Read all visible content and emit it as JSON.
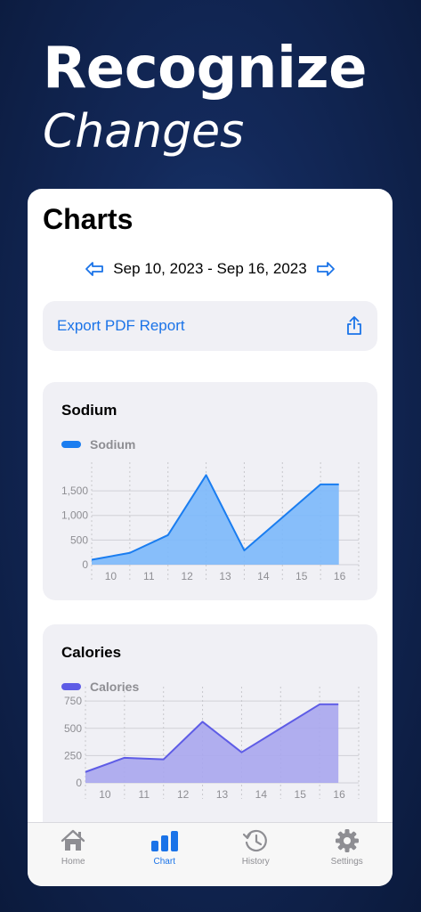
{
  "hero": {
    "title": "Recognize",
    "subtitle": "Changes"
  },
  "page": {
    "title": "Charts"
  },
  "date_nav": {
    "range": "Sep 10, 2023 - Sep 16, 2023"
  },
  "export": {
    "label": "Export PDF Report"
  },
  "colors": {
    "accent": "#1a73e8",
    "sodium": "#1a7df0",
    "calories": "#5e5ce6"
  },
  "tabs": [
    {
      "label": "Home",
      "icon": "house-icon",
      "active": false
    },
    {
      "label": "Chart",
      "icon": "bar-chart-icon",
      "active": true
    },
    {
      "label": "History",
      "icon": "history-clock-icon",
      "active": false
    },
    {
      "label": "Settings",
      "icon": "gear-icon",
      "active": false
    }
  ],
  "chart_data": [
    {
      "type": "area",
      "title": "Sodium",
      "legend": "Sodium",
      "x": [
        10,
        11,
        12,
        13,
        14,
        15,
        16
      ],
      "xticks": [
        "10",
        "11",
        "12",
        "13",
        "14",
        "15",
        "16"
      ],
      "yticks": [
        "0",
        "500",
        "1,000",
        "1,500"
      ],
      "ylim": [
        0,
        1900
      ],
      "series": [
        {
          "name": "Sodium",
          "points": [
            [
              9.5,
              100
            ],
            [
              10.5,
              240
            ],
            [
              11.5,
              600
            ],
            [
              12.5,
              1820
            ],
            [
              13.5,
              290
            ],
            [
              14.5,
              960
            ],
            [
              15.5,
              1630
            ],
            [
              15.98,
              1630
            ]
          ]
        }
      ]
    },
    {
      "type": "area",
      "title": "Calories",
      "legend": "Calories",
      "x": [
        10,
        11,
        12,
        13,
        14,
        15,
        16
      ],
      "xticks": [
        "10",
        "11",
        "12",
        "13",
        "14",
        "15",
        "16"
      ],
      "yticks": [
        "0",
        "250",
        "500",
        "750"
      ],
      "ylim": [
        0,
        800
      ],
      "series": [
        {
          "name": "Calories",
          "points": [
            [
              9.5,
              100
            ],
            [
              10.5,
              230
            ],
            [
              11.5,
              215
            ],
            [
              12.5,
              560
            ],
            [
              13.5,
              280
            ],
            [
              14.5,
              500
            ],
            [
              15.5,
              720
            ],
            [
              15.98,
              720
            ]
          ]
        }
      ]
    }
  ]
}
